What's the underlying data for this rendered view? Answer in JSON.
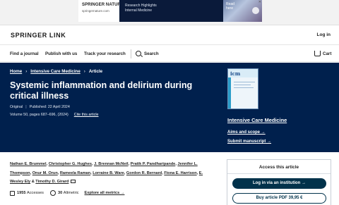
{
  "ad": {
    "brand": "SPRINGER NATURE",
    "url": "springernature.com",
    "headline_1": "Research Highlights",
    "headline_2": "Internal Medicine",
    "cta_1": "Read",
    "cta_2": "here"
  },
  "header": {
    "logo": "SPRINGER LINK",
    "login": "Log in"
  },
  "nav": {
    "find_journal": "Find a journal",
    "publish": "Publish with us",
    "track": "Track your research",
    "search": "Search",
    "cart": "Cart"
  },
  "breadcrumb": {
    "home": "Home",
    "journal": "Intensive Care Medicine",
    "current": "Article"
  },
  "article": {
    "title": "Systemic inflammation and delirium during critical illness",
    "type": "Original",
    "published": "Published: 22 April 2024",
    "volume": "Volume 50, pages 687–696, (2024)",
    "cite": "Cite this article"
  },
  "journal": {
    "cover_text": "ICM",
    "name": "Intensive Care Medicine",
    "aims": "Aims and scope →",
    "submit": "Submit manuscript →"
  },
  "authors": {
    "line1": [
      "Nathan E. Brummel",
      "Christopher G. Hughes",
      "J. Brennan McNeil",
      "Pratik P. Pandharipande",
      "Jennifer L."
    ],
    "line2": [
      "Thompson",
      "Onur M. Orun",
      "Rameela Raman",
      "Lorraine B. Ware",
      "Gordon R. Bernard",
      "Fiona E. Harrison",
      "E."
    ],
    "line3": [
      "Wesley Ely",
      "Timothy D. Girard"
    ]
  },
  "metrics": {
    "accesses_count": "1955",
    "accesses_label": "Accesses",
    "altmetric_count": "30",
    "altmetric_label": "Altmetric",
    "all_metrics": "Explore all metrics →"
  },
  "access_box": {
    "title": "Access this article",
    "login_button": "Log in via an institution →",
    "buy_button": "Buy article PDF 39,95 €"
  },
  "colors": {
    "hero_bg": "#00204d",
    "button_primary": "#01324b"
  }
}
